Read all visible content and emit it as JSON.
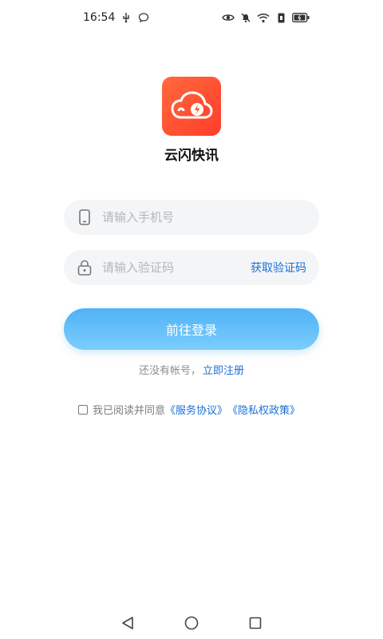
{
  "status_bar": {
    "time": "16:54",
    "icons_left": [
      "usb-icon",
      "chat-bubble-icon"
    ],
    "icons_right": [
      "eye-icon",
      "mute-bell-icon",
      "wifi-icon",
      "sim-icon",
      "battery-icon"
    ]
  },
  "app": {
    "name": "云闪快讯",
    "logo_colors": [
      "#ff6a3d",
      "#ff3d2a"
    ]
  },
  "form": {
    "phone_placeholder": "请输入手机号",
    "code_placeholder": "请输入验证码",
    "get_code_label": "获取验证码",
    "login_label": "前往登录"
  },
  "register": {
    "prompt": "还没有帐号，",
    "link": "立即注册"
  },
  "agreement": {
    "prefix": "我已阅读并同意",
    "service_link": "《服务协议》",
    "privacy_link": "《隐私权政策》"
  },
  "colors": {
    "link": "#1b6fd6",
    "button_gradient": [
      "#4fb2f7",
      "#7ccdfb"
    ]
  }
}
